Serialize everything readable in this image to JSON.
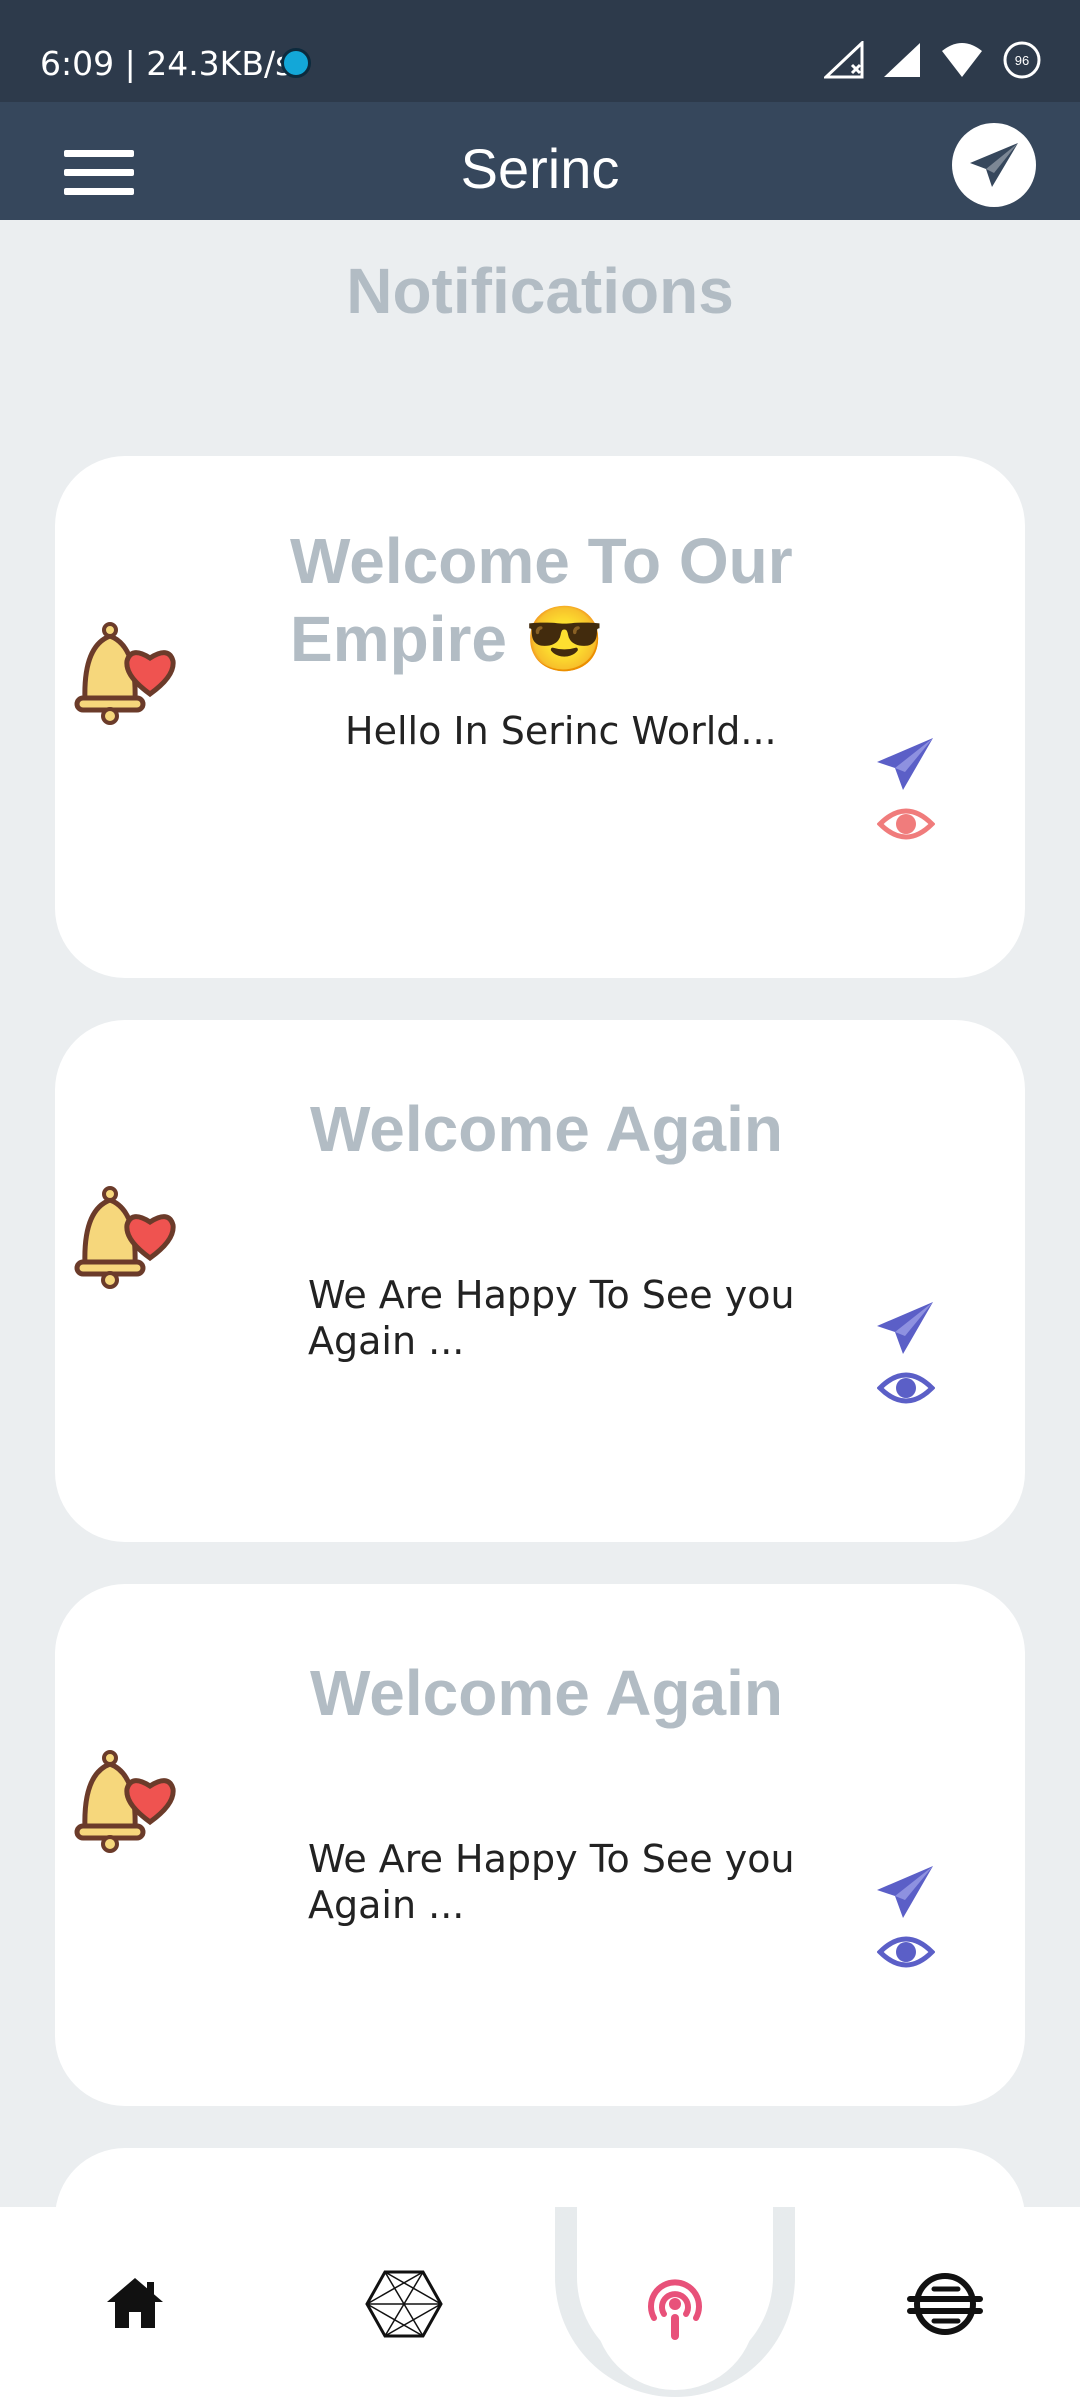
{
  "status_bar": {
    "time_speed": "6:09 | 24.3KB/s",
    "battery_level": "96"
  },
  "app_bar": {
    "title": "Serinc"
  },
  "page": {
    "title": "Notifications"
  },
  "notifications": [
    {
      "title_line1": "Welcome To Our",
      "title_line2": "Empire 😎",
      "message": "Hello In Serinc World...",
      "eye_color": "#f07c7c"
    },
    {
      "title": "Welcome Again",
      "message_line1": "We Are Happy To See you",
      "message_line2": "Again ...",
      "eye_color": "#5b5fc7"
    },
    {
      "title": "Welcome Again",
      "message_line1": "We Are Happy To See you",
      "message_line2": "Again ...",
      "eye_color": "#5b5fc7"
    }
  ],
  "colors": {
    "status_bar_bg": "#2d3a4b",
    "app_bar_bg": "#36475c",
    "page_bg": "#ebeef0",
    "title_gray": "#b2bcc4",
    "accent_purple": "#5b5fc7",
    "accent_pink": "#e8517a"
  },
  "icons": {
    "menu": "hamburger-menu-icon",
    "send": "paper-plane-icon",
    "bell": "bell-heart-icon",
    "view": "eye-icon",
    "home": "home-icon",
    "explore": "polyhedron-icon",
    "podcast": "podcast-icon",
    "community": "globe-icon"
  }
}
